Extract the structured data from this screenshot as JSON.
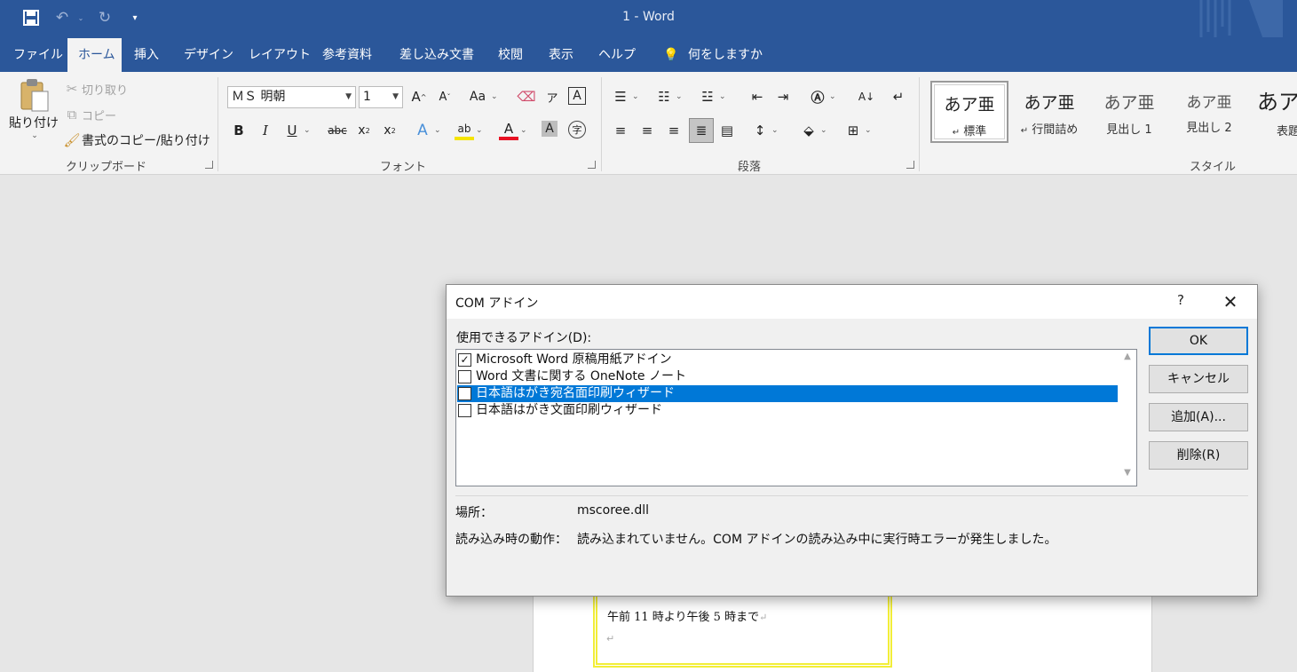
{
  "window": {
    "title": "1  -  Word",
    "accent": "#2b579a"
  },
  "tabs": [
    {
      "label": "ファイル"
    },
    {
      "label": "ホーム"
    },
    {
      "label": "挿入"
    },
    {
      "label": "デザイン"
    },
    {
      "label": "レイアウト"
    },
    {
      "label": "参考資料"
    },
    {
      "label": "差し込み文書"
    },
    {
      "label": "校閲"
    },
    {
      "label": "表示"
    },
    {
      "label": "ヘルプ"
    }
  ],
  "tell_me": "何をしますか",
  "clipboard": {
    "paste": "貼り付け",
    "cut": "切り取り",
    "copy": "コピー",
    "format_painter": "書式のコピー/貼り付け",
    "label": "クリップボード"
  },
  "font": {
    "name": "ＭＳ 明朝",
    "size": "1",
    "label": "フォント"
  },
  "paragraph": {
    "label": "段落"
  },
  "styles": {
    "label": "スタイル",
    "items": [
      {
        "sample": "あア亜",
        "name": "標準",
        "mark": "↵"
      },
      {
        "sample": "あア亜",
        "name": "行間詰め",
        "mark": "↵"
      },
      {
        "sample": "あア亜",
        "name": "見出し 1"
      },
      {
        "sample": "あア亜",
        "name": "見出し 2"
      },
      {
        "sample": "あア",
        "name": "表題"
      }
    ]
  },
  "document": {
    "line1": "午前 11 時より午後 5 時まで",
    "para_mark": "↵"
  },
  "dialog": {
    "title": "COM アドイン",
    "help": "?",
    "close": "✕",
    "list_label": "使用できるアドイン(D):",
    "addins": [
      {
        "label": "Microsoft Word 原稿用紙アドイン",
        "checked": true
      },
      {
        "label": "Word 文書に関する OneNote ノート",
        "checked": false
      },
      {
        "label": "日本語はがき宛名面印刷ウィザード",
        "checked": false,
        "selected": true
      },
      {
        "label": "日本語はがき文面印刷ウィザード",
        "checked": false
      }
    ],
    "buttons": {
      "ok": "OK",
      "cancel": "キャンセル",
      "add": "追加(A)...",
      "remove": "削除(R)"
    },
    "location_label": "場所：",
    "location_value": "mscoree.dll",
    "load_behavior_label": "読み込み時の動作：",
    "load_behavior_value": "読み込まれていません。COM アドインの読み込み中に実行時エラーが発生しました。"
  }
}
